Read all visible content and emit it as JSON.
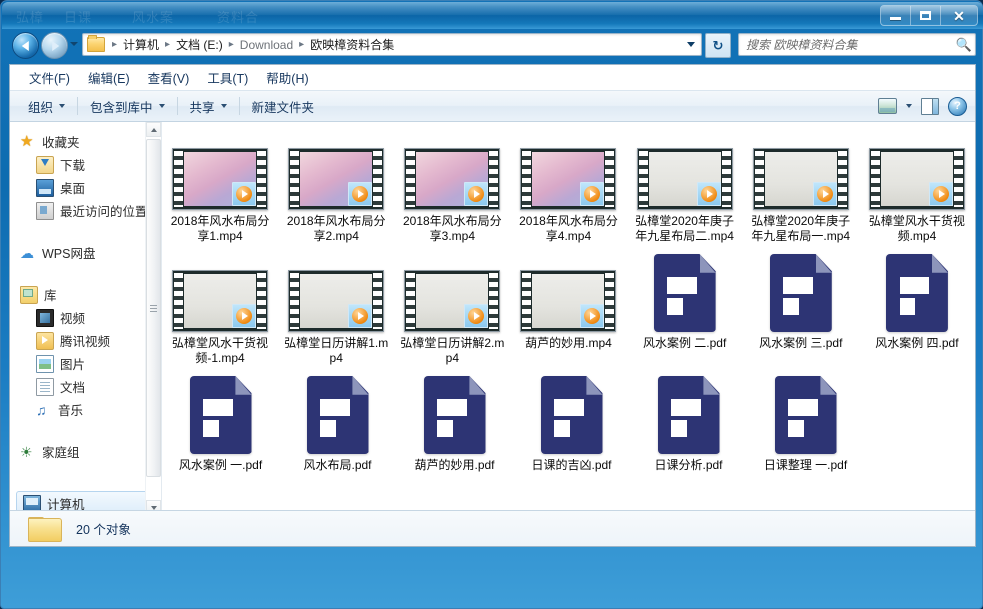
{
  "window": {
    "title": "",
    "controls": {
      "minimize": "–",
      "maximize": "□",
      "close": "✕"
    },
    "ghost_text_1": "弘樟",
    "ghost_text_2": "日课",
    "ghost_text_3": "风水案",
    "ghost_text_4": "资料合"
  },
  "nav": {
    "back_tooltip": "后退",
    "forward_tooltip": "前进",
    "history_dropdown": "▼",
    "refresh": "↻",
    "breadcrumbs": [
      {
        "label": "计算机",
        "dim": false
      },
      {
        "label": "文档 (E:)",
        "dim": false
      },
      {
        "label": "Download",
        "dim": true
      },
      {
        "label": "欧映樟资料合集",
        "dim": false
      }
    ],
    "separator": "▸"
  },
  "search": {
    "placeholder": "搜索 欧映樟资料合集",
    "value": "",
    "icon": "search-icon"
  },
  "menubar": [
    {
      "label": "文件(F)"
    },
    {
      "label": "编辑(E)"
    },
    {
      "label": "查看(V)"
    },
    {
      "label": "工具(T)"
    },
    {
      "label": "帮助(H)"
    }
  ],
  "toolbar": {
    "items": [
      {
        "label": "组织",
        "caret": true
      },
      {
        "label": "包含到库中",
        "caret": true
      },
      {
        "label": "共享",
        "caret": true
      },
      {
        "label": "新建文件夹",
        "caret": false
      }
    ],
    "right_icons": [
      "view-icon",
      "chevron-down-icon",
      "preview-pane-icon",
      "help-icon"
    ],
    "help_glyph": "?"
  },
  "sidebar": {
    "groups": [
      {
        "header": {
          "label": "收藏夹",
          "icon": "star-icon"
        },
        "items": [
          {
            "label": "下载",
            "icon": "download-icon"
          },
          {
            "label": "桌面",
            "icon": "desktop-icon"
          },
          {
            "label": "最近访问的位置",
            "icon": "recent-places-icon"
          }
        ]
      },
      {
        "header": {
          "label": "WPS网盘",
          "icon": "cloud-icon"
        },
        "items": []
      },
      {
        "header": {
          "label": "库",
          "icon": "library-icon"
        },
        "items": [
          {
            "label": "视频",
            "icon": "video-icon"
          },
          {
            "label": "腾讯视频",
            "icon": "tencent-video-icon"
          },
          {
            "label": "图片",
            "icon": "pictures-icon"
          },
          {
            "label": "文档",
            "icon": "documents-icon"
          },
          {
            "label": "音乐",
            "icon": "music-icon"
          }
        ]
      },
      {
        "header": {
          "label": "家庭组",
          "icon": "homegroup-icon"
        },
        "items": []
      },
      {
        "header": {
          "label": "计算机",
          "icon": "computer-icon",
          "selected": true
        },
        "items": []
      }
    ]
  },
  "files": [
    {
      "name": "2018年风水布局分享1.mp4",
      "type": "video",
      "thumb": "g-pinkblue"
    },
    {
      "name": "2018年风水布局分享2.mp4",
      "type": "video",
      "thumb": "g-pinkblue"
    },
    {
      "name": "2018年风水布局分享3.mp4",
      "type": "video",
      "thumb": "g-pinkblue"
    },
    {
      "name": "2018年风水布局分享4.mp4",
      "type": "video",
      "thumb": "g-pinkblue"
    },
    {
      "name": "弘樟堂2020年庚子年九星布局二.mp4",
      "type": "video",
      "thumb": "g-white"
    },
    {
      "name": "弘樟堂2020年庚子年九星布局一.mp4",
      "type": "video",
      "thumb": "g-white"
    },
    {
      "name": "弘樟堂风水干货视频.mp4",
      "type": "video",
      "thumb": "g-white"
    },
    {
      "name": "弘樟堂风水干货视频-1.mp4",
      "type": "video",
      "thumb": "g-white"
    },
    {
      "name": "弘樟堂日历讲解1.mp4",
      "type": "video",
      "thumb": "g-white"
    },
    {
      "name": "弘樟堂日历讲解2.mp4",
      "type": "video",
      "thumb": "g-white"
    },
    {
      "name": "葫芦的妙用.mp4",
      "type": "video",
      "thumb": "g-white"
    },
    {
      "name": "风水案例 二.pdf",
      "type": "pdf",
      "thumb": ""
    },
    {
      "name": "风水案例 三.pdf",
      "type": "pdf",
      "thumb": ""
    },
    {
      "name": "风水案例 四.pdf",
      "type": "pdf",
      "thumb": ""
    },
    {
      "name": "风水案例 一.pdf",
      "type": "pdf",
      "thumb": ""
    },
    {
      "name": "风水布局.pdf",
      "type": "pdf",
      "thumb": ""
    },
    {
      "name": "葫芦的妙用.pdf",
      "type": "pdf",
      "thumb": ""
    },
    {
      "name": "日课的吉凶.pdf",
      "type": "pdf",
      "thumb": ""
    },
    {
      "name": "日课分析.pdf",
      "type": "pdf",
      "thumb": ""
    },
    {
      "name": "日课整理 一.pdf",
      "type": "pdf",
      "thumb": ""
    }
  ],
  "status": {
    "item_count_text": "20 个对象",
    "folder_icon": "folder-icon"
  },
  "colors": {
    "window_blue": "#1273b8",
    "pdf_navy": "#2d3474",
    "accent_orange": "#f08a12",
    "breadcrumb_text": "#1b1b1b",
    "menu_text": "#17375e"
  }
}
